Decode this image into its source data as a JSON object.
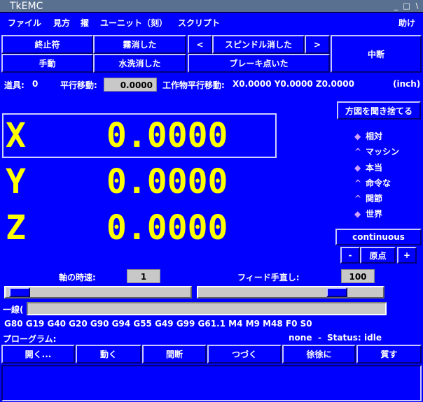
{
  "window": {
    "title": "TkEMC",
    "min": "_",
    "max": "□",
    "close": "\\"
  },
  "menu": {
    "items": [
      "ファイル",
      "見方",
      "擢",
      "ユーニット（刻）",
      "スクリプト"
    ],
    "help": "助け"
  },
  "buttons": {
    "row1": [
      "終止符",
      "霧消した",
      "<",
      "スピンドル消した",
      ">"
    ],
    "row2": [
      "手動",
      "水洗消した",
      "ブレーキ点いた"
    ],
    "abort": "中断"
  },
  "info": {
    "tool_label": "道具:",
    "tool_value": "0",
    "offset_label": "平行移動:",
    "offset_value": "0.0000",
    "work_label": "工作物平行移動:",
    "work_value": "X0.0000 Y0.0000 Z0.0000",
    "units": "(inch)"
  },
  "axes": [
    {
      "name": "X",
      "value": "0.0000"
    },
    {
      "name": "Y",
      "value": "0.0000"
    },
    {
      "name": "Z",
      "value": "0.0000"
    }
  ],
  "side": {
    "discard_button": "方図を聞き捨てる",
    "radio": [
      {
        "label": "相対",
        "selected": true
      },
      {
        "label": "マッシン",
        "selected": false
      },
      {
        "label": "本当",
        "selected": true
      },
      {
        "label": "命令な",
        "selected": false
      },
      {
        "label": "関節",
        "selected": false
      },
      {
        "label": "世界",
        "selected": true
      }
    ],
    "jog_mode": "continuous",
    "minus": "-",
    "home": "原点",
    "plus": "+"
  },
  "speed": {
    "axis_label": "軸の時速:",
    "axis_value": "1",
    "feed_label": "フィード手直し:",
    "feed_value": "100",
    "axis_slider_fraction": 0.02,
    "feed_slider_fraction": 0.78
  },
  "mdi": {
    "label": "一線(",
    "value": ""
  },
  "gcodes": "G80 G19 G40 G20 G90 G94 G55 G49 G99 G61.1 M4 M9 M48 F0 S0",
  "program": {
    "label": "プローグラム:",
    "file": "none",
    "dash": "-",
    "status_label": "Status:",
    "status": "idle"
  },
  "bottom_buttons": [
    "開く...",
    "動く",
    "間断",
    "つづく",
    "徐徐に",
    "質す"
  ],
  "colors": {
    "background": "#0000ff",
    "axis_text": "#ffff00",
    "field_bg": "#c8c8c8"
  }
}
